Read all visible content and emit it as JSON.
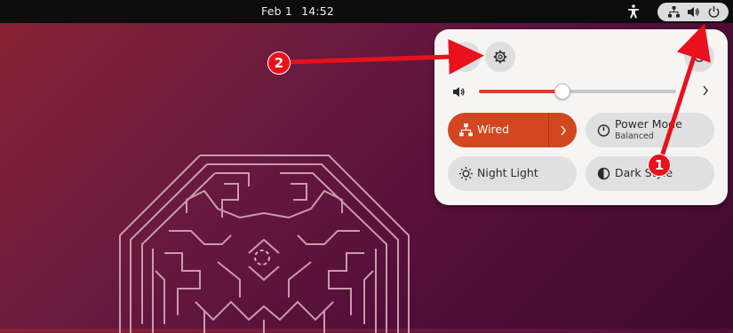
{
  "topbar": {
    "date": "Feb 1",
    "time": "14:52",
    "icons": [
      "accessibility-icon",
      "network-wired-icon",
      "volume-icon",
      "power-icon"
    ]
  },
  "quick_settings": {
    "settings_button_icon": "gear-icon",
    "power_button_icon": "power-icon",
    "volume": {
      "icon": "volume-icon",
      "level_percent": 42
    },
    "tiles": [
      {
        "id": "wired",
        "label": "Wired",
        "icon": "network-wired-icon",
        "active": true,
        "has_menu": true
      },
      {
        "id": "power-mode",
        "label": "Power Mode",
        "subtitle": "Balanced",
        "icon": "power-mode-icon",
        "active": false
      },
      {
        "id": "night-light",
        "label": "Night Light",
        "icon": "night-light-icon",
        "active": false
      },
      {
        "id": "dark-style",
        "label": "Dark Style",
        "icon": "dark-style-icon",
        "active": false
      }
    ]
  },
  "annotations": [
    {
      "number": "1",
      "color": "#e8111c"
    },
    {
      "number": "2",
      "color": "#e8111c"
    }
  ],
  "colors": {
    "accent": "#d34720",
    "topbar": "#0c0c0c",
    "panel": "#f6f5f4",
    "annotation_red": "#e8111c"
  }
}
